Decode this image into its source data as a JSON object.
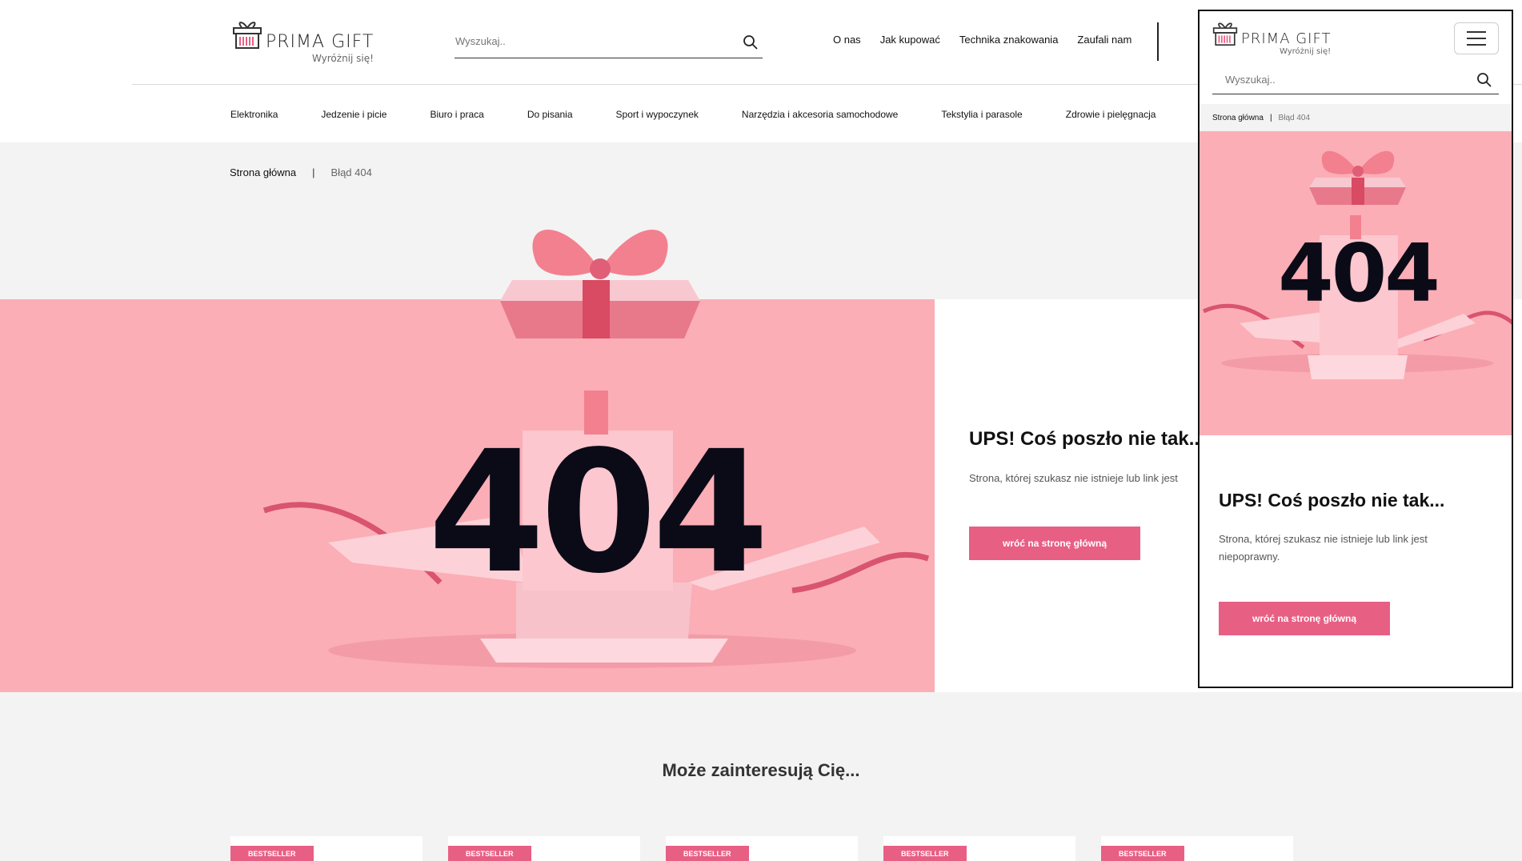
{
  "brand": {
    "name": "PRIMA GIFT",
    "tagline": "Wyróżnij się!"
  },
  "search": {
    "placeholder": "Wyszukaj.."
  },
  "topnav": [
    "O nas",
    "Jak kupować",
    "Technika znakowania",
    "Zaufali nam"
  ],
  "categories": [
    "Elektronika",
    "Jedzenie i picie",
    "Biuro i praca",
    "Do pisania",
    "Sport i wypoczynek",
    "Narzędzia i akcesoria samochodowe",
    "Tekstylia i parasole",
    "Zdrowie i pielęgnacja"
  ],
  "breadcrumb": {
    "home": "Strona główna",
    "current": "Błąd 404"
  },
  "error": {
    "code": "404",
    "title": "UPS! Coś poszło nie tak...",
    "desc": "Strona, której szukasz nie istnieje lub link jest niepoprawny.",
    "desc_visible": "Strona, której szukasz nie istnieje lub link jest",
    "button": "wróć na stronę główną"
  },
  "recommend": {
    "title": "Może zainteresują Cię..."
  },
  "products": [
    {
      "badge": "BESTSELLER"
    },
    {
      "badge": "BESTSELLER"
    },
    {
      "badge": "BESTSELLER"
    },
    {
      "badge": "BESTSELLER"
    },
    {
      "badge": "BESTSELLER"
    }
  ],
  "colors": {
    "accent": "#e85f84",
    "hero_pink": "#fbaeb6"
  },
  "icons": {
    "logo": "gift-box-icon",
    "search": "search-icon",
    "menu": "hamburger-menu-icon"
  }
}
